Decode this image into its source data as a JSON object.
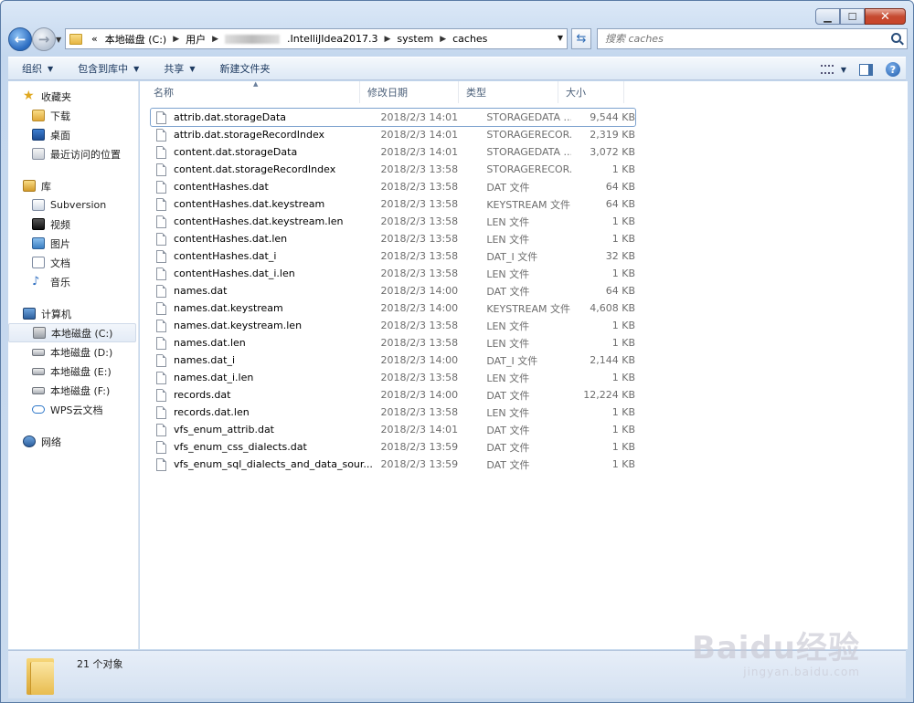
{
  "window": {
    "caption": {
      "minimize": "▁",
      "maximize": "☐",
      "close": "✕"
    }
  },
  "nav": {
    "back": "←",
    "forward": "→",
    "breadcrumb": {
      "overflow": "«",
      "items": [
        "本地磁盘 (C:)",
        "用户",
        ".IntelliJIdea2017.3",
        "system",
        "caches"
      ]
    },
    "search_placeholder": "搜索 caches"
  },
  "toolbar": {
    "organize": "组织",
    "include_in_library": "包含到库中",
    "share": "共享",
    "new_folder": "新建文件夹",
    "help": "?"
  },
  "sidebar": {
    "favorites": {
      "label": "收藏夹",
      "items": [
        "下载",
        "桌面",
        "最近访问的位置"
      ]
    },
    "libraries": {
      "label": "库",
      "items": [
        "Subversion",
        "视频",
        "图片",
        "文档",
        "音乐"
      ]
    },
    "computer": {
      "label": "计算机",
      "items": [
        "本地磁盘 (C:)",
        "本地磁盘 (D:)",
        "本地磁盘 (E:)",
        "本地磁盘 (F:)",
        "WPS云文档"
      ]
    },
    "network": {
      "label": "网络"
    }
  },
  "columns": {
    "name": "名称",
    "date": "修改日期",
    "type": "类型",
    "size": "大小"
  },
  "files": [
    {
      "name": "attrib.dat.storageData",
      "date": "2018/2/3 14:01",
      "type": "STORAGEDATA ...",
      "size": "9,544 KB"
    },
    {
      "name": "attrib.dat.storageRecordIndex",
      "date": "2018/2/3 14:01",
      "type": "STORAGERECOR...",
      "size": "2,319 KB"
    },
    {
      "name": "content.dat.storageData",
      "date": "2018/2/3 14:01",
      "type": "STORAGEDATA ...",
      "size": "3,072 KB"
    },
    {
      "name": "content.dat.storageRecordIndex",
      "date": "2018/2/3 13:58",
      "type": "STORAGERECOR...",
      "size": "1 KB"
    },
    {
      "name": "contentHashes.dat",
      "date": "2018/2/3 13:58",
      "type": "DAT 文件",
      "size": "64 KB"
    },
    {
      "name": "contentHashes.dat.keystream",
      "date": "2018/2/3 13:58",
      "type": "KEYSTREAM 文件",
      "size": "64 KB"
    },
    {
      "name": "contentHashes.dat.keystream.len",
      "date": "2018/2/3 13:58",
      "type": "LEN 文件",
      "size": "1 KB"
    },
    {
      "name": "contentHashes.dat.len",
      "date": "2018/2/3 13:58",
      "type": "LEN 文件",
      "size": "1 KB"
    },
    {
      "name": "contentHashes.dat_i",
      "date": "2018/2/3 13:58",
      "type": "DAT_I 文件",
      "size": "32 KB"
    },
    {
      "name": "contentHashes.dat_i.len",
      "date": "2018/2/3 13:58",
      "type": "LEN 文件",
      "size": "1 KB"
    },
    {
      "name": "names.dat",
      "date": "2018/2/3 14:00",
      "type": "DAT 文件",
      "size": "64 KB"
    },
    {
      "name": "names.dat.keystream",
      "date": "2018/2/3 14:00",
      "type": "KEYSTREAM 文件",
      "size": "4,608 KB"
    },
    {
      "name": "names.dat.keystream.len",
      "date": "2018/2/3 13:58",
      "type": "LEN 文件",
      "size": "1 KB"
    },
    {
      "name": "names.dat.len",
      "date": "2018/2/3 13:58",
      "type": "LEN 文件",
      "size": "1 KB"
    },
    {
      "name": "names.dat_i",
      "date": "2018/2/3 14:00",
      "type": "DAT_I 文件",
      "size": "2,144 KB"
    },
    {
      "name": "names.dat_i.len",
      "date": "2018/2/3 13:58",
      "type": "LEN 文件",
      "size": "1 KB"
    },
    {
      "name": "records.dat",
      "date": "2018/2/3 14:00",
      "type": "DAT 文件",
      "size": "12,224 KB"
    },
    {
      "name": "records.dat.len",
      "date": "2018/2/3 13:58",
      "type": "LEN 文件",
      "size": "1 KB"
    },
    {
      "name": "vfs_enum_attrib.dat",
      "date": "2018/2/3 14:01",
      "type": "DAT 文件",
      "size": "1 KB"
    },
    {
      "name": "vfs_enum_css_dialects.dat",
      "date": "2018/2/3 13:59",
      "type": "DAT 文件",
      "size": "1 KB"
    },
    {
      "name": "vfs_enum_sql_dialects_and_data_sour...",
      "date": "2018/2/3 13:59",
      "type": "DAT 文件",
      "size": "1 KB"
    }
  ],
  "status": {
    "count": "21 个对象"
  },
  "watermark": {
    "main": "Baidu经验",
    "sub": "jingyan.baidu.com"
  }
}
